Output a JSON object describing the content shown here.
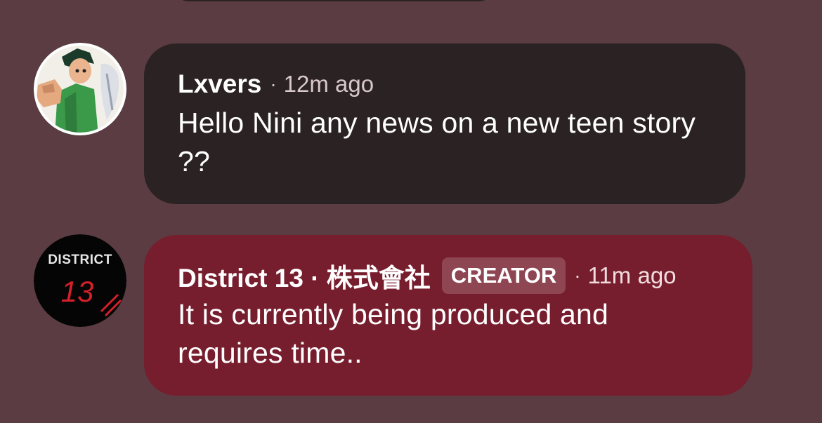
{
  "comments": [
    {
      "author": "Lxvers",
      "separator": "·",
      "time": "12m ago",
      "text": "Hello Nini any news on a new teen story ??",
      "avatar_icon": "anime-character-avatar-icon"
    },
    {
      "author": "District 13 · 株式會社",
      "badge": "CREATOR",
      "separator": "·",
      "time": "11m ago",
      "text": "It is currently being produced and requires time..",
      "avatar_icon": "district-13-logo-icon",
      "avatar_logo_text": "DISTRICT 13"
    }
  ],
  "colors": {
    "background": "#5a3c42",
    "comment_bubble": "#2b2223",
    "creator_bubble": "#771e2e",
    "logo_red": "#d4202a"
  }
}
